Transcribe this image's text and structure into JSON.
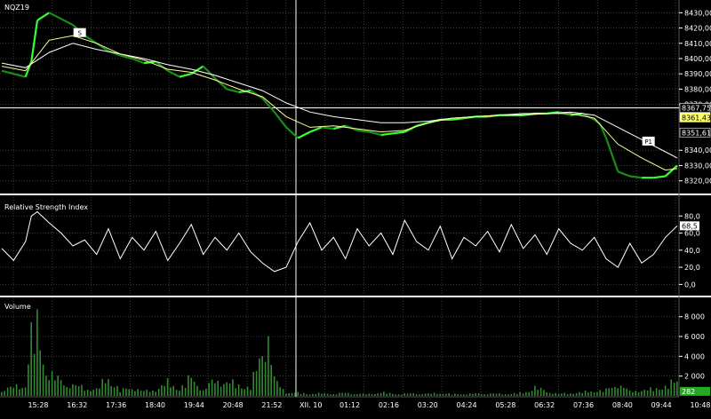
{
  "colors": {
    "background": "#000000",
    "grid": "#3c3c3c",
    "separator": "#ffffff",
    "candle_up": "#33ff33",
    "candle_dn": "#1a8c1a",
    "ma_fast": "#ffff99",
    "ma_slow": "#ffffff",
    "rsi": "#ffffff",
    "volume": "#2e8b2e",
    "price_tag_yellow": "#ffff66",
    "volume_tag": "#22aa22"
  },
  "panels": {
    "price": {
      "title": "NQZ19"
    },
    "rsi": {
      "title": "Relative Strength Index"
    },
    "volume": {
      "title": "Volume"
    }
  },
  "markers": [
    {
      "label": "S",
      "time": "16:08",
      "value": 8417
    },
    {
      "label": "P1",
      "time": "10:02",
      "value": 8346
    }
  ],
  "chart_data": [
    {
      "type": "line",
      "panel": "price",
      "title": "NQZ19",
      "y_ticks": [
        "8430,00",
        "8420,00",
        "8410,00",
        "8400,00",
        "8390,00",
        "8380,00",
        "8370,00",
        "8340,00",
        "8330,00",
        "8320,00"
      ],
      "ylim": [
        8314,
        8436
      ],
      "x_ticks": [
        "15:28",
        "16:32",
        "17:36",
        "18:40",
        "19:44",
        "20:48",
        "21:52",
        "XII. 10",
        "01:12",
        "02:16",
        "03:20",
        "04:24",
        "05:28",
        "06:32",
        "07:36",
        "08:40",
        "09:44",
        "10:48"
      ],
      "price_labels": [
        "8367,75",
        "8361,43",
        "8351,61"
      ],
      "crosshair_value": 8367.75,
      "series": [
        {
          "role": "price",
          "x": [
            0,
            2,
            4,
            5,
            6,
            8,
            10,
            12,
            14,
            16,
            18,
            20,
            22,
            24,
            26,
            28,
            30,
            32,
            34,
            36,
            38,
            40,
            42,
            44,
            46,
            48,
            50,
            52,
            54,
            56,
            58,
            60,
            62,
            64,
            66,
            68,
            70,
            72,
            74,
            76,
            78,
            80,
            82,
            84,
            86,
            88,
            90,
            92,
            94,
            96,
            98,
            100,
            101,
            102,
            104,
            106,
            108,
            110,
            112,
            114
          ],
          "y": [
            8392,
            8390,
            8388,
            8398,
            8425,
            8430,
            8426,
            8422,
            8415,
            8410,
            8405,
            8402,
            8400,
            8397,
            8398,
            8392,
            8388,
            8390,
            8395,
            8387,
            8380,
            8378,
            8379,
            8374,
            8365,
            8355,
            8348,
            8352,
            8355,
            8354,
            8356,
            8353,
            8352,
            8350,
            8351,
            8352,
            8356,
            8358,
            8360,
            8360,
            8361,
            8362,
            8362,
            8363,
            8363,
            8363,
            8364,
            8364,
            8365,
            8363,
            8364,
            8360,
            8357,
            8348,
            8326,
            8323,
            8322,
            8322,
            8323,
            8330
          ]
        },
        {
          "role": "moving-average-fast",
          "x": [
            0,
            4,
            8,
            12,
            16,
            20,
            24,
            28,
            32,
            36,
            40,
            44,
            48,
            52,
            56,
            60,
            64,
            68,
            72,
            76,
            80,
            84,
            88,
            92,
            96,
            100,
            104,
            108,
            112,
            114
          ],
          "y": [
            8395,
            8392,
            8412,
            8415,
            8410,
            8403,
            8399,
            8393,
            8391,
            8386,
            8380,
            8375,
            8362,
            8355,
            8356,
            8354,
            8352,
            8353,
            8358,
            8361,
            8362,
            8363,
            8363,
            8364,
            8364,
            8361,
            8344,
            8335,
            8327,
            8328
          ]
        },
        {
          "role": "moving-average-slow",
          "x": [
            0,
            4,
            8,
            12,
            16,
            20,
            24,
            28,
            32,
            36,
            40,
            44,
            48,
            52,
            56,
            60,
            64,
            68,
            72,
            76,
            80,
            84,
            88,
            92,
            96,
            100,
            104,
            108,
            112,
            114
          ],
          "y": [
            8397,
            8394,
            8404,
            8410,
            8406,
            8403,
            8400,
            8396,
            8393,
            8389,
            8384,
            8379,
            8371,
            8365,
            8362,
            8360,
            8358,
            8358,
            8359,
            8361,
            8362,
            8363,
            8364,
            8364,
            8365,
            8363,
            8355,
            8347,
            8339,
            8335
          ]
        }
      ]
    },
    {
      "type": "line",
      "panel": "rsi",
      "title": "Relative Strength Index",
      "y_ticks": [
        "80,0",
        "60,0",
        "40,0",
        "20,0",
        "0,0"
      ],
      "ylim": [
        -10,
        100
      ],
      "last_value_label": "68,5",
      "series": [
        {
          "role": "rsi",
          "x": [
            0,
            2,
            4,
            5,
            6,
            8,
            10,
            12,
            14,
            16,
            18,
            20,
            22,
            24,
            26,
            28,
            30,
            32,
            34,
            36,
            38,
            40,
            42,
            44,
            46,
            48,
            50,
            52,
            54,
            56,
            58,
            60,
            62,
            64,
            66,
            68,
            70,
            72,
            74,
            76,
            78,
            80,
            82,
            84,
            86,
            88,
            90,
            92,
            94,
            96,
            98,
            100,
            102,
            104,
            106,
            108,
            110,
            112,
            114
          ],
          "y": [
            42,
            28,
            50,
            80,
            85,
            72,
            60,
            45,
            52,
            35,
            65,
            30,
            55,
            40,
            62,
            28,
            48,
            70,
            35,
            55,
            40,
            60,
            38,
            25,
            15,
            20,
            50,
            72,
            40,
            55,
            30,
            65,
            45,
            60,
            35,
            75,
            50,
            40,
            68,
            30,
            55,
            45,
            62,
            38,
            70,
            42,
            58,
            35,
            65,
            48,
            40,
            55,
            30,
            20,
            48,
            25,
            35,
            55,
            68.5
          ]
        }
      ]
    },
    {
      "type": "bar",
      "panel": "volume",
      "title": "Volume",
      "y_ticks": [
        "8 000",
        "6 000",
        "4 000",
        "2 000"
      ],
      "ylim": [
        0,
        9500
      ],
      "last_value_label": "282",
      "series": [
        {
          "role": "volume",
          "x": [
            0,
            2,
            4,
            5,
            6,
            7,
            8,
            10,
            12,
            14,
            16,
            18,
            20,
            22,
            24,
            26,
            28,
            30,
            32,
            34,
            36,
            38,
            40,
            42,
            44,
            45,
            46,
            48,
            50,
            52,
            54,
            56,
            58,
            60,
            62,
            64,
            66,
            68,
            70,
            72,
            74,
            76,
            78,
            80,
            82,
            84,
            86,
            88,
            90,
            92,
            94,
            96,
            98,
            100,
            102,
            104,
            105,
            106,
            108,
            110,
            112,
            114
          ],
          "y": [
            900,
            1200,
            1600,
            8200,
            9200,
            5400,
            3100,
            2000,
            1500,
            1100,
            900,
            2600,
            700,
            1200,
            600,
            900,
            1800,
            1000,
            2500,
            800,
            2200,
            1900,
            1500,
            1200,
            6200,
            9000,
            2200,
            500,
            400,
            300,
            350,
            300,
            400,
            300,
            250,
            500,
            300,
            300,
            350,
            300,
            400,
            250,
            300,
            300,
            350,
            300,
            300,
            400,
            1200,
            600,
            300,
            400,
            500,
            700,
            800,
            1700,
            1200,
            600,
            800,
            900,
            1400,
            2000
          ]
        }
      ]
    }
  ]
}
